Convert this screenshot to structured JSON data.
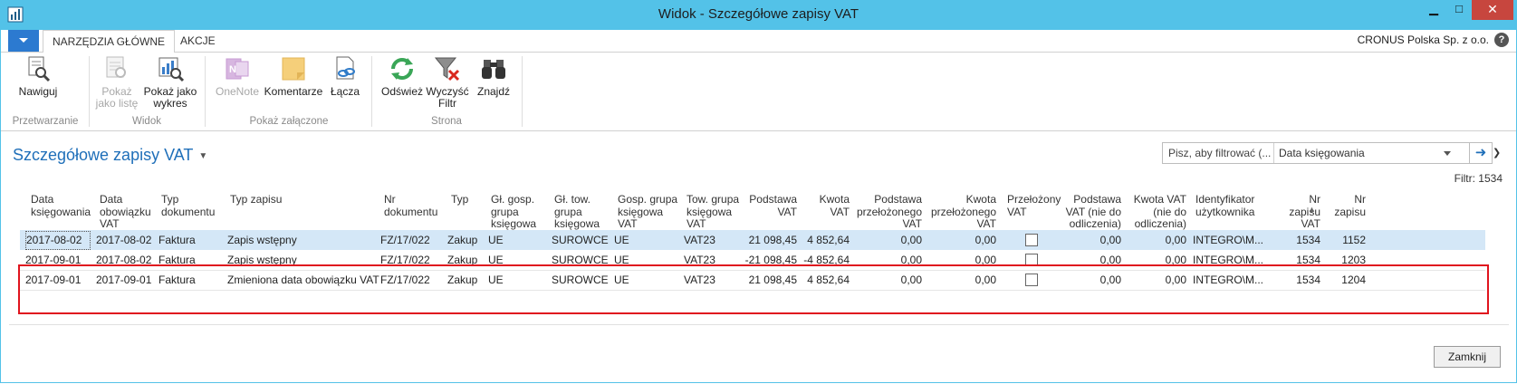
{
  "window": {
    "title": "Widok - Szczegółowe zapisy VAT",
    "minimize": "▁",
    "maximize": "□",
    "close": "✕"
  },
  "tabs": {
    "home": "NARZĘDZIA GŁÓWNE",
    "actions": "AKCJE"
  },
  "company": "CRONUS Polska Sp. z o.o.",
  "help": "?",
  "ribbon": {
    "navigate": "Nawiguj",
    "show_list_1": "Pokaż",
    "show_list_2": "jako listę",
    "show_chart_1": "Pokaż jako",
    "show_chart_2": "wykres",
    "onenote": "OneNote",
    "comments": "Komentarze",
    "links": "Łącza",
    "refresh": "Odśwież",
    "clear_filter_1": "Wyczyść",
    "clear_filter_2": "Filtr",
    "find": "Znajdź",
    "groups": {
      "processing": "Przetwarzanie",
      "view": "Widok",
      "show_attached": "Pokaż załączone",
      "page": "Strona"
    }
  },
  "page": {
    "title": "Szczegółowe zapisy VAT",
    "filter_placeholder": "Pisz, aby filtrować (...",
    "filter_field": "Data księgowania",
    "filter_count": "Filtr: 1534"
  },
  "columns": {
    "posting_date": [
      "Data",
      "księgowania"
    ],
    "vat_date": [
      "Data",
      "obowiązku",
      "VAT"
    ],
    "doc_type": [
      "Typ",
      "dokumentu"
    ],
    "entry_type": [
      "Typ zapisu"
    ],
    "doc_no": [
      "Nr",
      "dokumentu"
    ],
    "type": [
      "Typ"
    ],
    "gen_bus": [
      "Gł. gosp.",
      "grupa",
      "księgowa"
    ],
    "gen_prod": [
      "Gł. tow.",
      "grupa",
      "księgowa"
    ],
    "vat_bus": [
      "Gosp. grupa",
      "księgowa",
      "VAT"
    ],
    "vat_prod": [
      "Tow. grupa",
      "księgowa",
      "VAT"
    ],
    "base": [
      "Podstawa",
      "VAT"
    ],
    "amount": [
      "Kwota",
      "VAT"
    ],
    "unreal_base": [
      "Podstawa",
      "przełożonego",
      "VAT"
    ],
    "unreal_amount": [
      "Kwota",
      "przełożonego",
      "VAT"
    ],
    "deferred": [
      "Przełożony",
      "VAT"
    ],
    "nd_base": [
      "Podstawa",
      "VAT (nie do",
      "odliczenia)"
    ],
    "nd_amount": [
      "Kwota VAT",
      "(nie do",
      "odliczenia)"
    ],
    "user": [
      "Identyfikator",
      "użytkownika"
    ],
    "vat_entry_no": [
      "Nr",
      "zapisu",
      "VAT"
    ],
    "entry_no": [
      "Nr",
      "zapisu"
    ]
  },
  "rows": [
    {
      "posting_date": "2017-08-02",
      "vat_date": "2017-08-02",
      "doc_type": "Faktura",
      "entry_type": "Zapis wstępny",
      "doc_no": "FZ/17/022",
      "type": "Zakup",
      "gen_bus": "UE",
      "gen_prod": "SUROWCE",
      "vat_bus": "UE",
      "vat_prod": "VAT23",
      "base": "21 098,45",
      "amount": "4 852,64",
      "unreal_base": "0,00",
      "unreal_amount": "0,00",
      "deferred": false,
      "nd_base": "0,00",
      "nd_amount": "0,00",
      "user": "INTEGRO\\M...",
      "vat_entry_no": "1534",
      "entry_no": "1152"
    },
    {
      "posting_date": "2017-09-01",
      "vat_date": "2017-08-02",
      "doc_type": "Faktura",
      "entry_type": "Zapis wstępny",
      "doc_no": "FZ/17/022",
      "type": "Zakup",
      "gen_bus": "UE",
      "gen_prod": "SUROWCE",
      "vat_bus": "UE",
      "vat_prod": "VAT23",
      "base": "-21 098,45",
      "amount": "-4 852,64",
      "unreal_base": "0,00",
      "unreal_amount": "0,00",
      "deferred": false,
      "nd_base": "0,00",
      "nd_amount": "0,00",
      "user": "INTEGRO\\M...",
      "vat_entry_no": "1534",
      "entry_no": "1203"
    },
    {
      "posting_date": "2017-09-01",
      "vat_date": "2017-09-01",
      "doc_type": "Faktura",
      "entry_type": "Zmieniona data obowiązku VAT",
      "doc_no": "FZ/17/022",
      "type": "Zakup",
      "gen_bus": "UE",
      "gen_prod": "SUROWCE",
      "vat_bus": "UE",
      "vat_prod": "VAT23",
      "base": "21 098,45",
      "amount": "4 852,64",
      "unreal_base": "0,00",
      "unreal_amount": "0,00",
      "deferred": false,
      "nd_base": "0,00",
      "nd_amount": "0,00",
      "user": "INTEGRO\\M...",
      "vat_entry_no": "1534",
      "entry_no": "1204"
    }
  ],
  "close_button": "Zamknij",
  "colors": {
    "titlebar": "#53c2e8",
    "accent": "#1f6fb9",
    "selected_row": "#d4e7f7",
    "highlight_box": "#e0141e"
  }
}
